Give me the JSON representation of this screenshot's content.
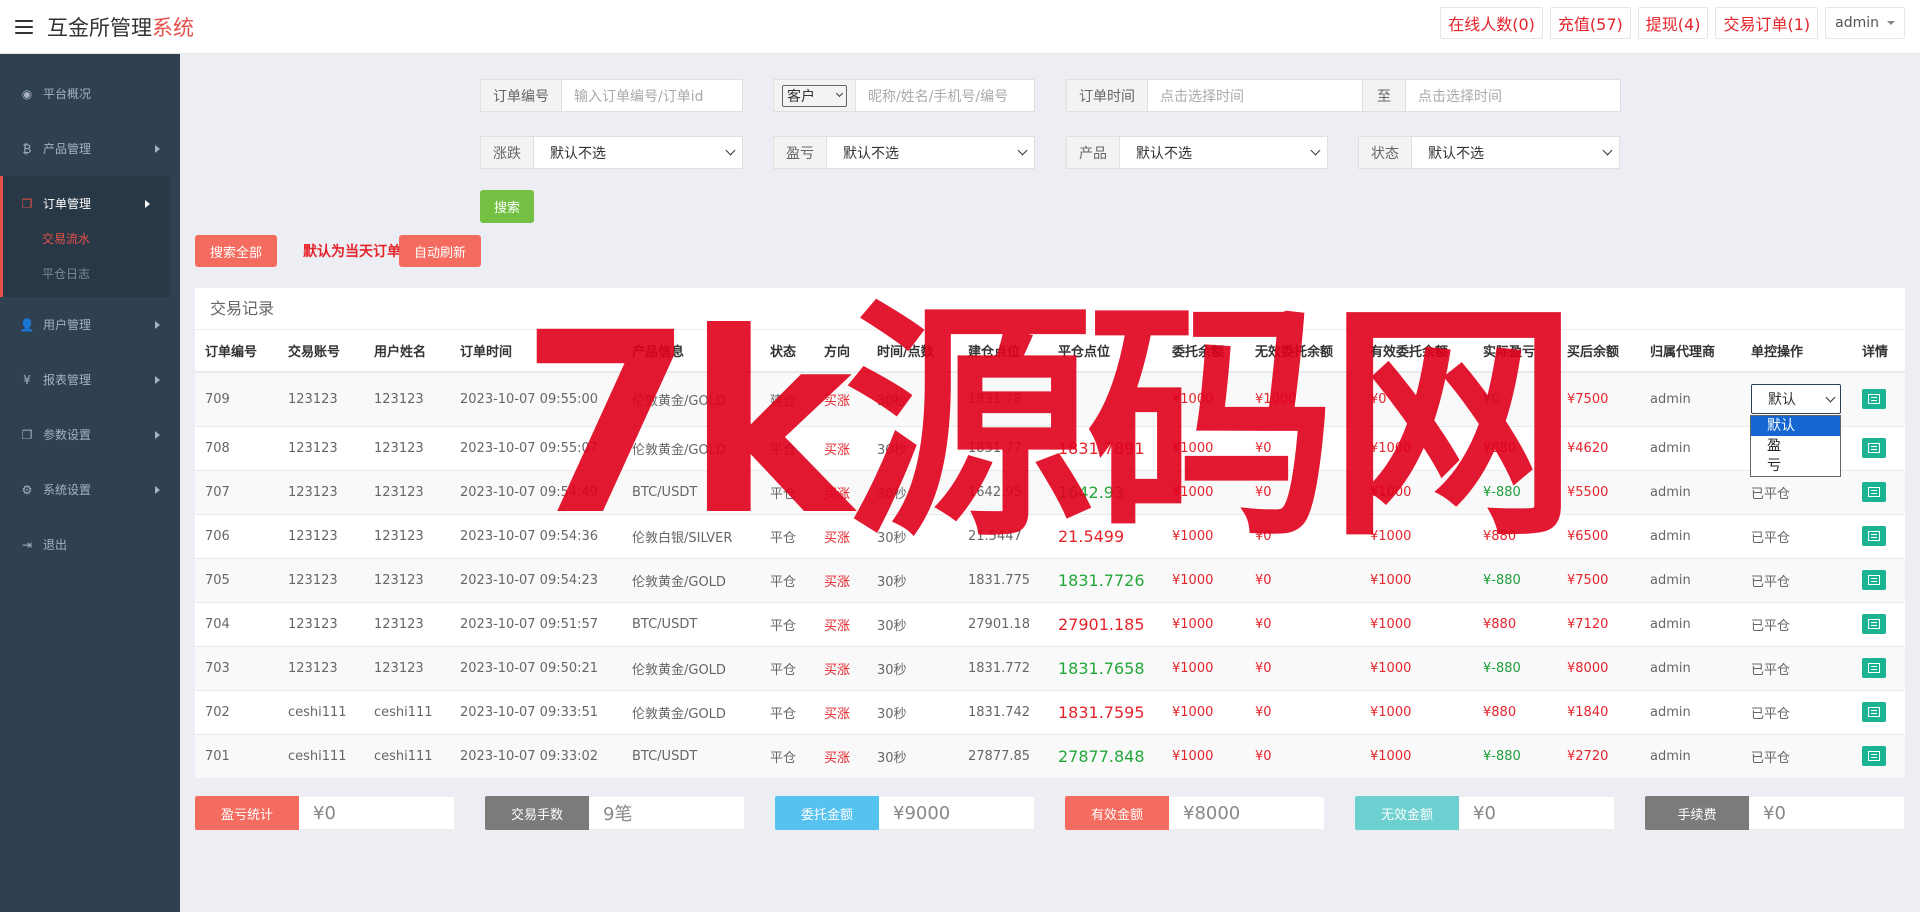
{
  "header": {
    "brand_main": "互金所管理",
    "brand_accent": "系统",
    "links": [
      "在线人数(0)",
      "充值(57)",
      "提现(4)",
      "交易订单(1)"
    ],
    "user": "admin"
  },
  "sidebar": {
    "items": [
      {
        "label": "平台概况",
        "icon": "dashboard-icon"
      },
      {
        "label": "产品管理",
        "icon": "bitcoin-icon"
      },
      {
        "label": "订单管理",
        "icon": "copy-icon"
      },
      {
        "label": "用户管理",
        "icon": "user-icon"
      },
      {
        "label": "报表管理",
        "icon": "yen-icon"
      },
      {
        "label": "参数设置",
        "icon": "copy-icon"
      },
      {
        "label": "系统设置",
        "icon": "gears-icon"
      },
      {
        "label": "退出",
        "icon": "sign-out-icon"
      }
    ],
    "sub_items": [
      "交易流水",
      "平仓日志"
    ]
  },
  "filters": {
    "order_no_label": "订单编号",
    "order_no_placeholder": "输入订单编号/订单id",
    "customer_select": "客户",
    "customer_placeholder": "昵称/姓名/手机号/编号",
    "order_time_label": "订单时间",
    "time_placeholder_start": "点击选择时间",
    "to_label": "至",
    "time_placeholder_end": "点击选择时间",
    "rise_fall_label": "涨跌",
    "profit_label": "盈亏",
    "product_label": "产品",
    "status_label": "状态",
    "default_option": "默认不选",
    "search_btn": "搜索"
  },
  "actions": {
    "search_all": "搜索全部",
    "notice": "默认为当天订单",
    "auto_refresh": "自动刷新"
  },
  "table": {
    "title": "交易记录",
    "headers": [
      "订单编号",
      "交易账号",
      "用户姓名",
      "订单时间",
      "产品信息",
      "状态",
      "方向",
      "时间/点数",
      "建仓点位",
      "平仓点位",
      "委托余额",
      "无效委托余额",
      "有效委托余额",
      "实际盈亏",
      "买后余额",
      "归属代理商",
      "单控操作",
      "详情"
    ],
    "rows": [
      {
        "id": "709",
        "account": "123123",
        "name": "123123",
        "time": "2023-10-07 09:55:00",
        "product": "伦敦黄金/GOLD",
        "status": "建仓",
        "dir": "买涨",
        "dur": "30秒",
        "open": "1831.78",
        "close": "",
        "close_color": "",
        "entrust": "¥1000",
        "invalid": "¥1000",
        "valid": "¥0",
        "pnl": "¥0",
        "after": "¥7500",
        "agent": "admin",
        "op": "默认"
      },
      {
        "id": "708",
        "account": "123123",
        "name": "123123",
        "time": "2023-10-07 09:55:07",
        "product": "伦敦黄金/GOLD",
        "status": "平仓",
        "dir": "买涨",
        "dur": "30秒",
        "open": "1831.77",
        "close": "1831.7891",
        "close_color": "red",
        "entrust": "¥1000",
        "invalid": "¥0",
        "valid": "¥1000",
        "pnl": "¥880",
        "after": "¥4620",
        "agent": "admin",
        "op": "已平仓"
      },
      {
        "id": "707",
        "account": "123123",
        "name": "123123",
        "time": "2023-10-07 09:54:49",
        "product": "BTC/USDT",
        "status": "平仓",
        "dir": "买涨",
        "dur": "30秒",
        "open": "1642.95",
        "close": "1642.93",
        "close_color": "green",
        "entrust": "¥1000",
        "invalid": "¥0",
        "valid": "¥1000",
        "pnl": "¥-880",
        "after": "¥5500",
        "agent": "admin",
        "op": "已平仓"
      },
      {
        "id": "706",
        "account": "123123",
        "name": "123123",
        "time": "2023-10-07 09:54:36",
        "product": "伦敦白银/SILVER",
        "status": "平仓",
        "dir": "买涨",
        "dur": "30秒",
        "open": "21.5447",
        "close": "21.5499",
        "close_color": "red",
        "entrust": "¥1000",
        "invalid": "¥0",
        "valid": "¥1000",
        "pnl": "¥880",
        "after": "¥6500",
        "agent": "admin",
        "op": "已平仓"
      },
      {
        "id": "705",
        "account": "123123",
        "name": "123123",
        "time": "2023-10-07 09:54:23",
        "product": "伦敦黄金/GOLD",
        "status": "平仓",
        "dir": "买涨",
        "dur": "30秒",
        "open": "1831.775",
        "close": "1831.7726",
        "close_color": "green",
        "entrust": "¥1000",
        "invalid": "¥0",
        "valid": "¥1000",
        "pnl": "¥-880",
        "after": "¥7500",
        "agent": "admin",
        "op": "已平仓"
      },
      {
        "id": "704",
        "account": "123123",
        "name": "123123",
        "time": "2023-10-07 09:51:57",
        "product": "BTC/USDT",
        "status": "平仓",
        "dir": "买涨",
        "dur": "30秒",
        "open": "27901.18",
        "close": "27901.185",
        "close_color": "red",
        "entrust": "¥1000",
        "invalid": "¥0",
        "valid": "¥1000",
        "pnl": "¥880",
        "after": "¥7120",
        "agent": "admin",
        "op": "已平仓"
      },
      {
        "id": "703",
        "account": "123123",
        "name": "123123",
        "time": "2023-10-07 09:50:21",
        "product": "伦敦黄金/GOLD",
        "status": "平仓",
        "dir": "买涨",
        "dur": "30秒",
        "open": "1831.772",
        "close": "1831.7658",
        "close_color": "green",
        "entrust": "¥1000",
        "invalid": "¥0",
        "valid": "¥1000",
        "pnl": "¥-880",
        "after": "¥8000",
        "agent": "admin",
        "op": "已平仓"
      },
      {
        "id": "702",
        "account": "ceshi111",
        "name": "ceshi111",
        "time": "2023-10-07 09:33:51",
        "product": "伦敦黄金/GOLD",
        "status": "平仓",
        "dir": "买涨",
        "dur": "30秒",
        "open": "1831.742",
        "close": "1831.7595",
        "close_color": "red",
        "entrust": "¥1000",
        "invalid": "¥0",
        "valid": "¥1000",
        "pnl": "¥880",
        "after": "¥1840",
        "agent": "admin",
        "op": "已平仓"
      },
      {
        "id": "701",
        "account": "ceshi111",
        "name": "ceshi111",
        "time": "2023-10-07 09:33:02",
        "product": "BTC/USDT",
        "status": "平仓",
        "dir": "买涨",
        "dur": "30秒",
        "open": "27877.85",
        "close": "27877.848",
        "close_color": "green",
        "entrust": "¥1000",
        "invalid": "¥0",
        "valid": "¥1000",
        "pnl": "¥-880",
        "after": "¥2720",
        "agent": "admin",
        "op": "已平仓"
      }
    ],
    "op_options": [
      "默认",
      "盈",
      "亏"
    ]
  },
  "stats": [
    {
      "label": "盈亏统计",
      "value": "¥0",
      "color": "#f46c5f"
    },
    {
      "label": "交易手数",
      "value": "9笔",
      "color": "#7b7b7b"
    },
    {
      "label": "委托金额",
      "value": "¥9000",
      "color": "#55c2ef"
    },
    {
      "label": "有效金额",
      "value": "¥8000",
      "color": "#f46c5f"
    },
    {
      "label": "无效金额",
      "value": "¥0",
      "color": "#6ccfd0"
    },
    {
      "label": "手续费",
      "value": "¥0",
      "color": "#7b7b7b"
    }
  ],
  "watermark": "7k源码网"
}
